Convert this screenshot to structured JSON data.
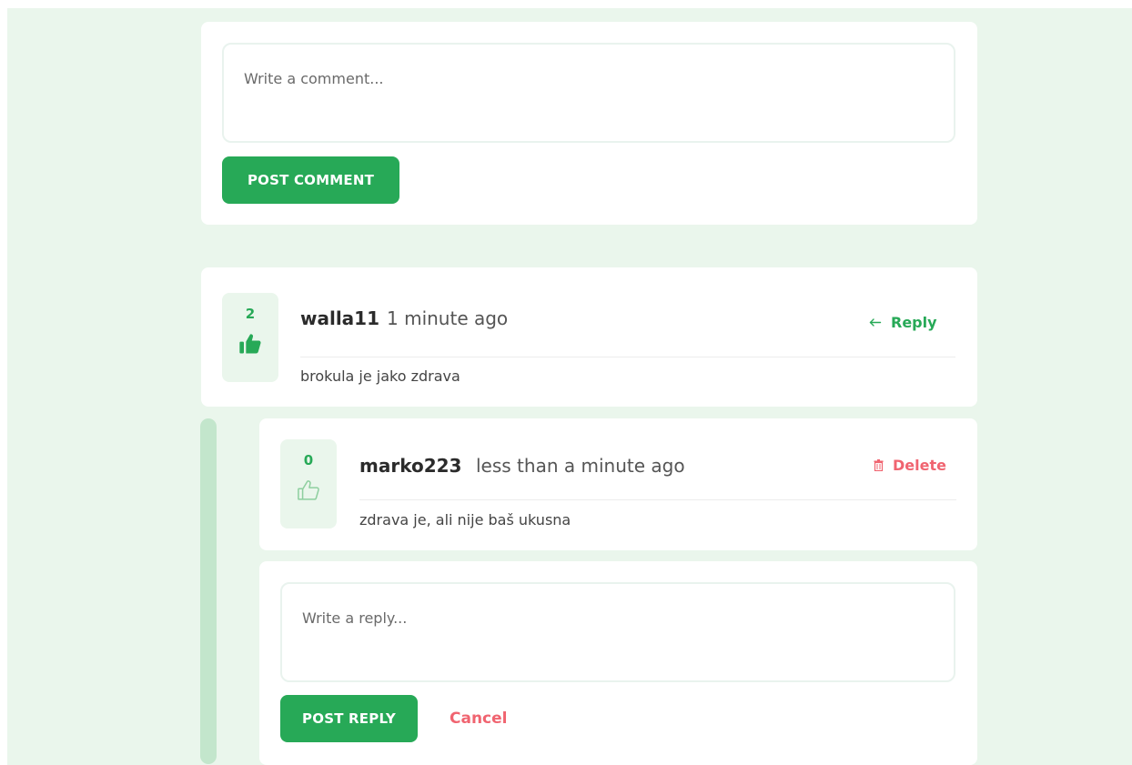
{
  "comment_form": {
    "placeholder": "Write a comment...",
    "submit_label": "POST COMMENT"
  },
  "comments": [
    {
      "votes": "2",
      "username": "walla11",
      "timestamp": "1 minute ago",
      "text": "brokula je jako zdrava",
      "action_label": "Reply",
      "liked": true
    }
  ],
  "replies": [
    {
      "votes": "0",
      "username": "marko223",
      "timestamp": "less than a minute ago",
      "text": "zdrava je, ali nije baš ukusna",
      "action_label": "Delete",
      "liked": false
    }
  ],
  "reply_form": {
    "placeholder": "Write a reply...",
    "submit_label": "POST REPLY",
    "cancel_label": "Cancel"
  },
  "colors": {
    "accent": "#27a957",
    "danger": "#f06470",
    "background": "#eaf6ec"
  }
}
